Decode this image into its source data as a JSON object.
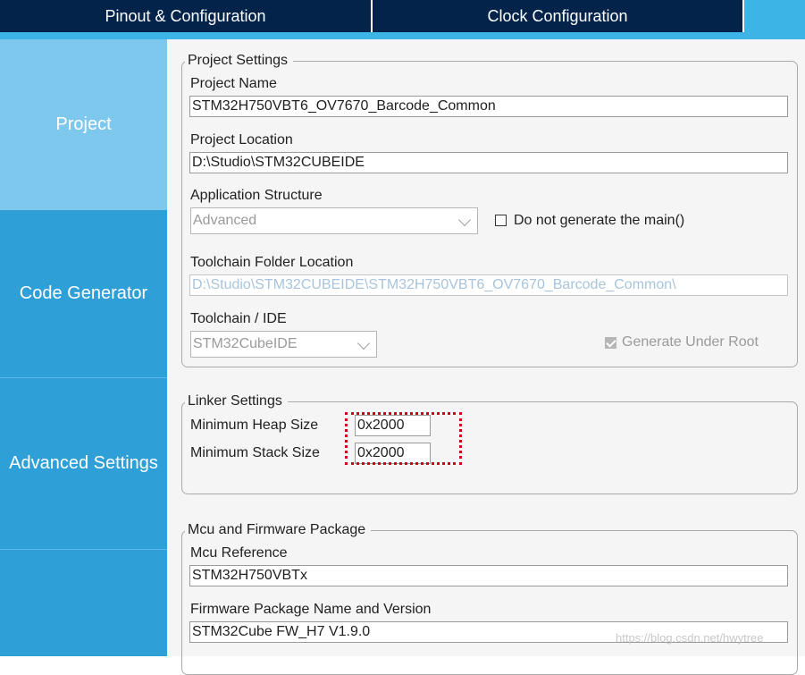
{
  "tabs": [
    {
      "label": "Pinout & Configuration"
    },
    {
      "label": "Clock Configuration"
    }
  ],
  "sidebar": {
    "items": [
      {
        "label": "Project",
        "active": true
      },
      {
        "label": "Code Generator",
        "active": false
      },
      {
        "label": "Advanced Settings",
        "active": false
      }
    ]
  },
  "project_settings": {
    "legend": "Project Settings",
    "project_name_label": "Project Name",
    "project_name_value": "STM32H750VBT6_OV7670_Barcode_Common",
    "project_location_label": "Project Location",
    "project_location_value": "D:\\Studio\\STM32CUBEIDE",
    "app_structure_label": "Application Structure",
    "app_structure_value": "Advanced",
    "no_main_label": "Do not generate the main()",
    "no_main_checked": false,
    "toolchain_folder_label": "Toolchain Folder Location",
    "toolchain_folder_value": "D:\\Studio\\STM32CUBEIDE\\STM32H750VBT6_OV7670_Barcode_Common\\",
    "toolchain_ide_label": "Toolchain / IDE",
    "toolchain_ide_value": "STM32CubeIDE",
    "generate_under_root_label": "Generate Under Root",
    "generate_under_root_checked": true
  },
  "linker_settings": {
    "legend": "Linker Settings",
    "heap_label": "Minimum Heap Size",
    "heap_value": "0x2000",
    "stack_label": "Minimum Stack Size",
    "stack_value": "0x2000"
  },
  "mcu_firmware": {
    "legend": "Mcu and Firmware Package",
    "mcu_ref_label": "Mcu Reference",
    "mcu_ref_value": "STM32H750VBTx",
    "fw_label": "Firmware Package Name and Version",
    "fw_value": "STM32Cube FW_H7 V1.9.0"
  },
  "watermark": "https://blog.csdn.net/hwytree",
  "colors": {
    "tab_bg": "#03234b",
    "accent": "#3cb4e6",
    "sidebar_bg": "#2e9fd7",
    "sidebar_active": "#7ec8ee",
    "highlight": "#d0021b"
  }
}
